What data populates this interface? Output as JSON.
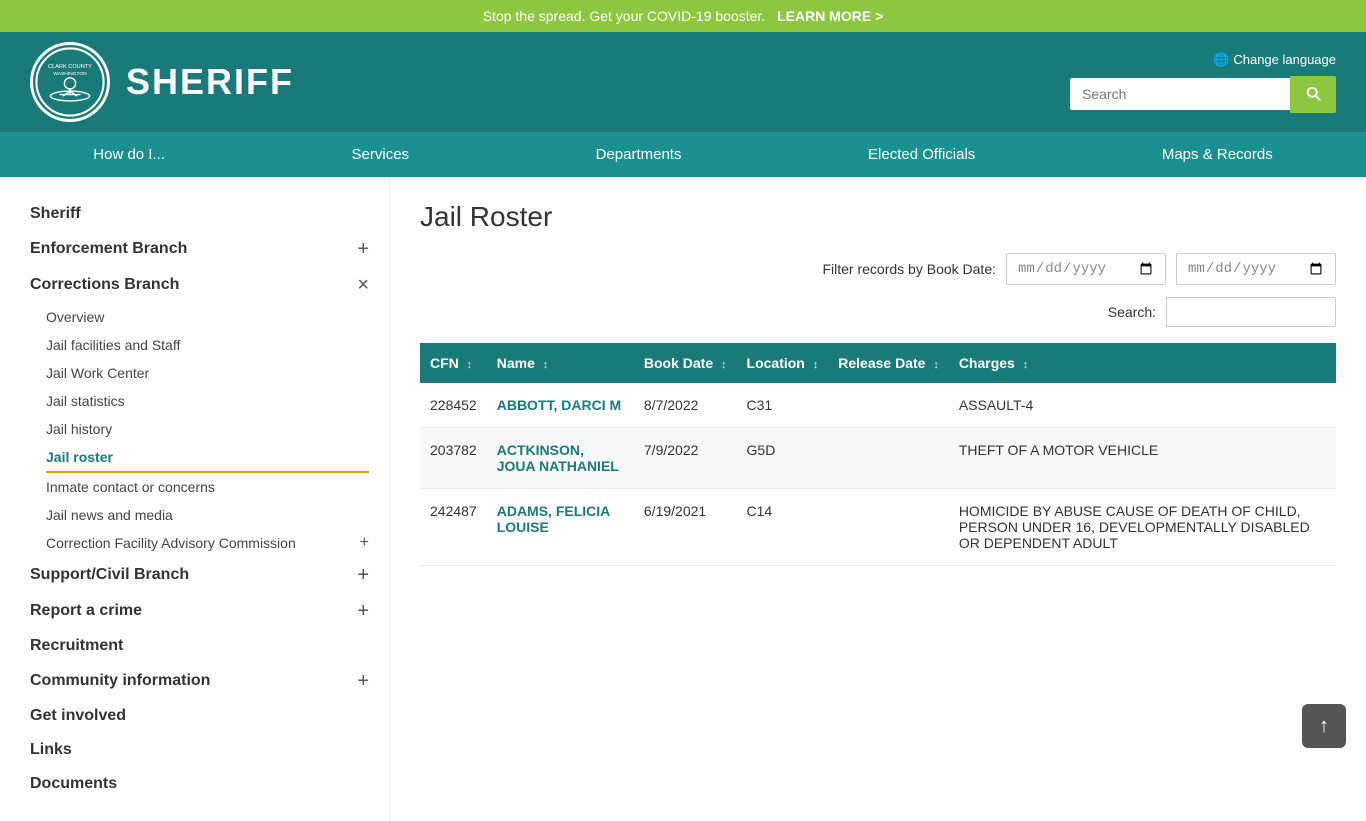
{
  "covid_banner": {
    "message": "Stop the spread. Get your COVID-19 booster.",
    "link_text": "LEARN MORE >"
  },
  "header": {
    "logo_alt": "Clark County Washington Sheriff Logo",
    "title": "SHERIFF",
    "change_language": "Change language",
    "search_placeholder": "Search"
  },
  "nav": {
    "items": [
      {
        "label": "How do I...",
        "id": "how-do-i"
      },
      {
        "label": "Services",
        "id": "services"
      },
      {
        "label": "Departments",
        "id": "departments"
      },
      {
        "label": "Elected Officials",
        "id": "elected-officials"
      },
      {
        "label": "Maps & Records",
        "id": "maps-records"
      }
    ]
  },
  "sidebar": {
    "top_item": "Sheriff",
    "sections": [
      {
        "label": "Enforcement Branch",
        "toggle": "+",
        "id": "enforcement-branch",
        "sub_items": []
      },
      {
        "label": "Corrections Branch",
        "toggle": "×",
        "id": "corrections-branch",
        "sub_items": [
          {
            "label": "Overview",
            "active": false
          },
          {
            "label": "Jail facilities and Staff",
            "active": false
          },
          {
            "label": "Jail Work Center",
            "active": false
          },
          {
            "label": "Jail statistics",
            "active": false
          },
          {
            "label": "Jail history",
            "active": false
          },
          {
            "label": "Jail roster",
            "active": true
          },
          {
            "label": "Inmate contact or concerns",
            "active": false
          },
          {
            "label": "Jail news and media",
            "active": false
          },
          {
            "label": "Correction Facility Advisory Commission",
            "active": false,
            "toggle": "+"
          }
        ]
      },
      {
        "label": "Support/Civil Branch",
        "toggle": "+",
        "id": "support-civil-branch",
        "sub_items": []
      },
      {
        "label": "Report a crime",
        "toggle": "+",
        "id": "report-a-crime",
        "sub_items": []
      }
    ],
    "plain_items": [
      "Recruitment",
      "Community information",
      "Get involved",
      "Links",
      "Documents"
    ],
    "community_toggle": "+"
  },
  "content": {
    "page_title": "Jail Roster",
    "filter_label": "Filter records by Book Date:",
    "date_placeholder_1": "mm/dd/yyyy",
    "date_placeholder_2": "mm/dd/yyyy",
    "search_label": "Search:",
    "table": {
      "columns": [
        {
          "label": "CFN",
          "key": "cfn"
        },
        {
          "label": "Name",
          "key": "name"
        },
        {
          "label": "Book Date",
          "key": "book_date"
        },
        {
          "label": "Location",
          "key": "location"
        },
        {
          "label": "Release Date",
          "key": "release_date"
        },
        {
          "label": "Charges",
          "key": "charges"
        }
      ],
      "rows": [
        {
          "cfn": "228452",
          "name": "ABBOTT, DARCI M",
          "book_date": "8/7/2022",
          "location": "C31",
          "release_date": "",
          "charges": "ASSAULT-4"
        },
        {
          "cfn": "203782",
          "name": "ACTKINSON, JOUA NATHANIEL",
          "book_date": "7/9/2022",
          "location": "G5D",
          "release_date": "",
          "charges": "THEFT OF A MOTOR VEHICLE"
        },
        {
          "cfn": "242487",
          "name": "ADAMS, FELICIA LOUISE",
          "book_date": "6/19/2021",
          "location": "C14",
          "release_date": "",
          "charges": "HOMICIDE BY ABUSE CAUSE OF DEATH OF CHILD, PERSON UNDER 16, DEVELOPMENTALLY DISABLED OR DEPENDENT ADULT"
        }
      ]
    }
  },
  "scroll_top_label": "↑"
}
